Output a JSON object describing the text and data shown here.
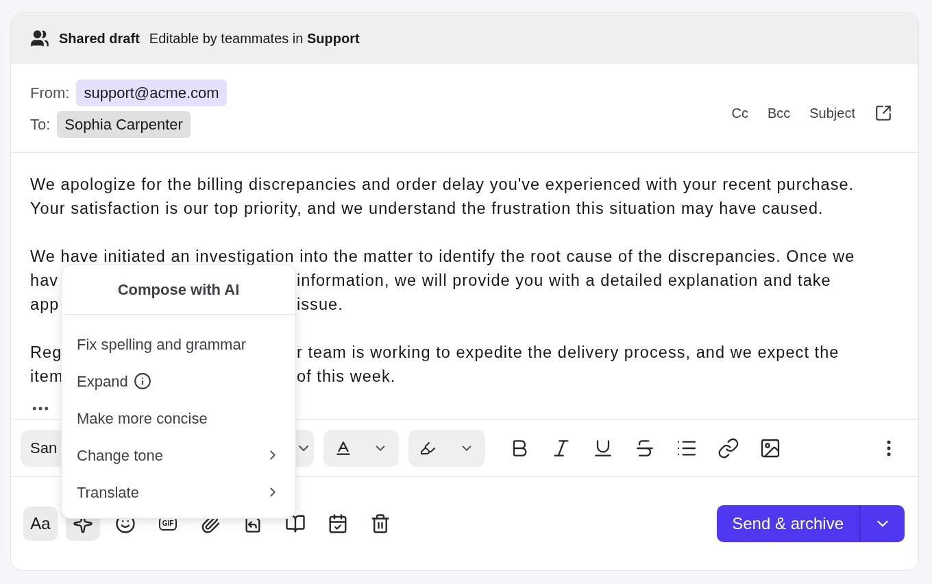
{
  "header": {
    "title": "Shared draft",
    "subtitle": "Editable by teammates in **Support**"
  },
  "from": {
    "label": "From:",
    "value": "support@acme.com"
  },
  "to": {
    "label": "To:",
    "value": "Sophia Carpenter"
  },
  "recipient_links": [
    "Cc",
    "Bcc",
    "Subject"
  ],
  "body_paragraphs": [
    {
      "lines": [
        {
          "left": "We apologize for the billing discrepancies and order delay you've experienced with your recent purchase."
        },
        {
          "left": "Your satisfaction is our top priority, and we understand the frustration this situation may have caused."
        }
      ]
    },
    {
      "lines": [
        {
          "left": "We have initiated an investigation into the matter to identify the root cause of the discrepancies. Once we"
        },
        {
          "left": "hav",
          "right": "information, we will provide you with a detailed explanation and take"
        },
        {
          "left": "app",
          "right": "issue."
        }
      ]
    },
    {
      "lines": [
        {
          "left": "Reg",
          "right": "r team is working to expedite the delivery process, and we expect the"
        },
        {
          "left": "item",
          "right": "of this week."
        }
      ]
    }
  ],
  "format_toolbar": {
    "font_select": {
      "value": "San"
    }
  },
  "ai_menu": {
    "title": "Compose with AI",
    "items": [
      {
        "label": "Fix spelling and grammar",
        "kind": "plain"
      },
      {
        "label": "Expand",
        "kind": "info"
      },
      {
        "label": "Make more concise",
        "kind": "plain"
      },
      {
        "label": "Change tone",
        "kind": "submenu"
      },
      {
        "label": "Translate",
        "kind": "submenu"
      }
    ]
  },
  "bottom_tools": [
    {
      "label": "Aa",
      "selected": true
    },
    {
      "selected": true
    },
    {
      "selected": false
    },
    {
      "label": "GIF",
      "selected": false
    },
    {
      "selected": false
    },
    {
      "selected": false
    },
    {
      "selected": false
    },
    {
      "selected": false
    },
    {
      "selected": false
    }
  ],
  "send_button": {
    "label": "Send & archive"
  }
}
